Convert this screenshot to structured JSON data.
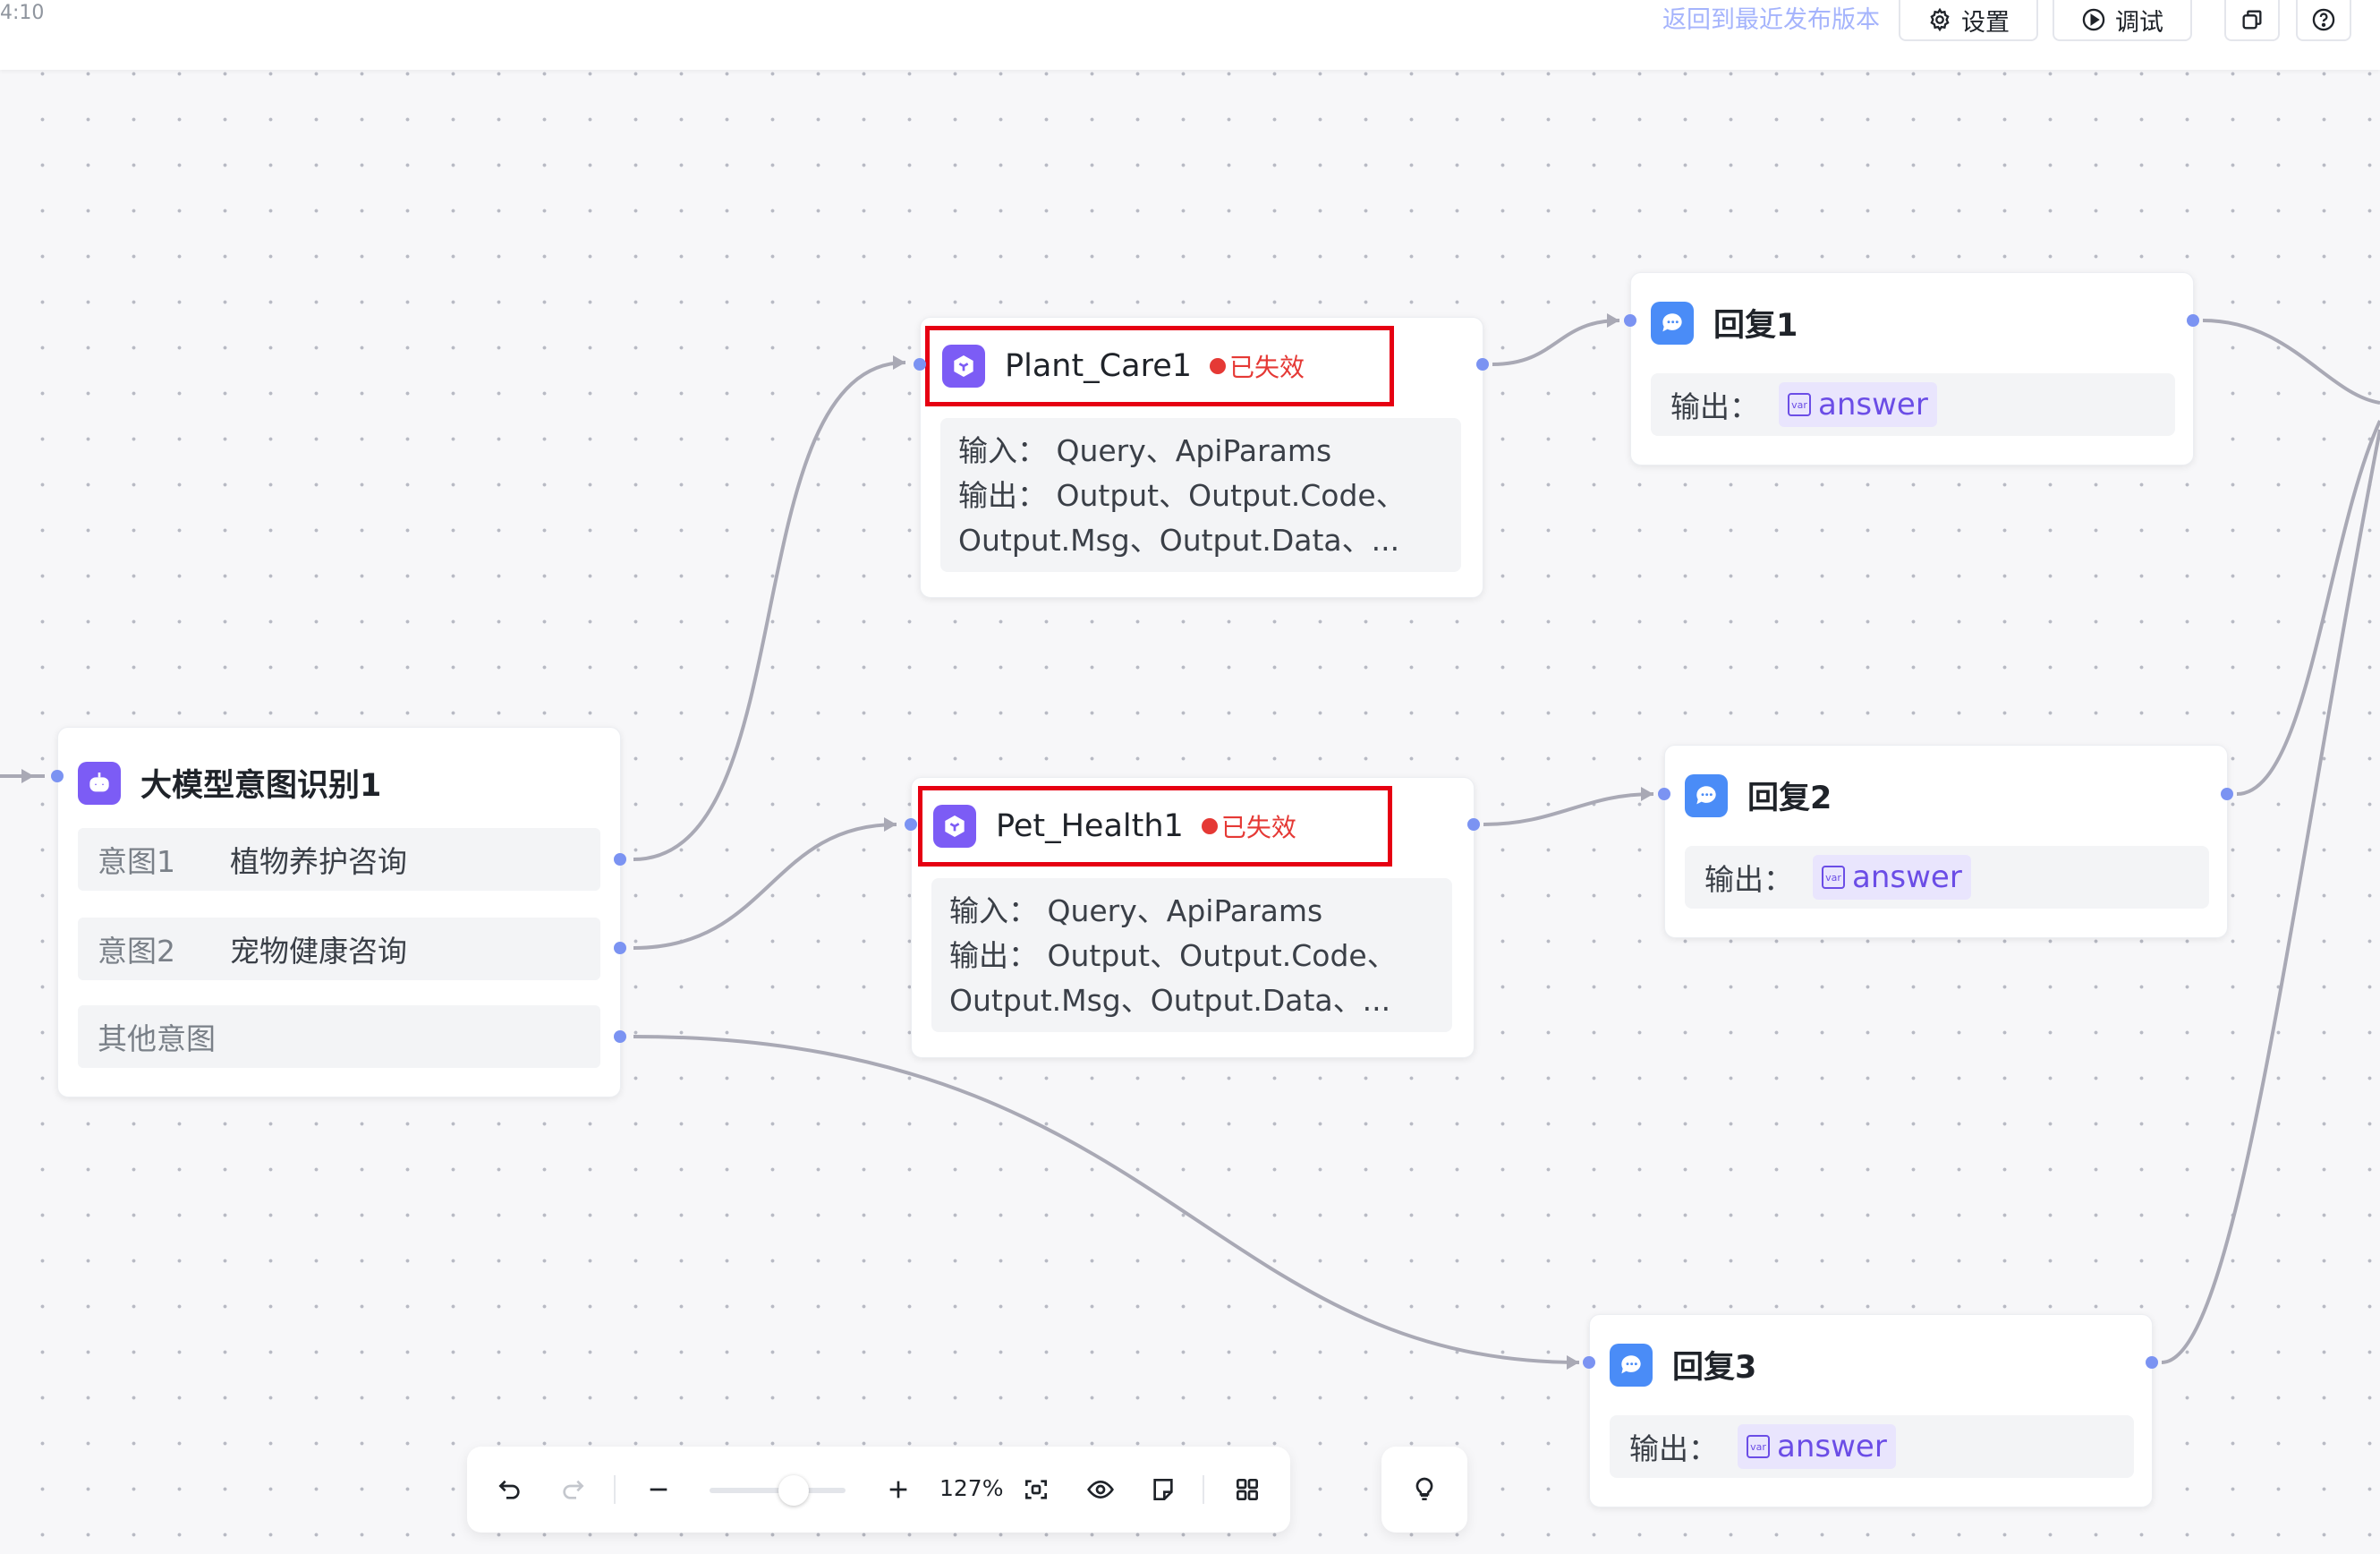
{
  "topbar": {
    "time": "4:10",
    "revert_label": "返回到最近发布版本",
    "settings_label": "设置",
    "debug_label": "调试"
  },
  "nodes": {
    "intent": {
      "title": "大模型意图识别1",
      "intents": [
        {
          "label": "意图1",
          "value": "植物养护咨询"
        },
        {
          "label": "意图2",
          "value": "宠物健康咨询"
        },
        {
          "label": "其他意图",
          "value": ""
        }
      ]
    },
    "plant": {
      "title": "Plant_Care1",
      "status": "已失效",
      "lines": [
        "输入：  Query、ApiParams",
        "输出：  Output、Output.Code、",
        "Output.Msg、Output.Data、..."
      ]
    },
    "pet": {
      "title": "Pet_Health1",
      "status": "已失效",
      "lines": [
        "输入：  Query、ApiParams",
        "输出：  Output、Output.Code、",
        "Output.Msg、Output.Data、..."
      ]
    },
    "reply1": {
      "title": "回复1",
      "output_label": "输出：",
      "var_tag": "var",
      "var_name": "answer"
    },
    "reply2": {
      "title": "回复2",
      "output_label": "输出：",
      "var_tag": "var",
      "var_name": "answer"
    },
    "reply3": {
      "title": "回复3",
      "output_label": "输出：",
      "var_tag": "var",
      "var_name": "answer"
    }
  },
  "toolbar": {
    "zoom": "127%"
  },
  "colors": {
    "accent_purple": "#7c5cf5",
    "accent_blue": "#4a8cf7",
    "error_red": "#e53935",
    "edge": "#a9a9b5",
    "port": "#7b93f2"
  },
  "icons": [
    "undo-icon",
    "redo-icon",
    "zoom-out-icon",
    "zoom-in-icon",
    "fit-view-icon",
    "eye-icon",
    "note-icon",
    "grid-icon",
    "bulb-icon",
    "settings-icon",
    "play-icon",
    "copy-icon",
    "help-icon",
    "plugin-icon",
    "robot-icon",
    "chat-icon"
  ]
}
